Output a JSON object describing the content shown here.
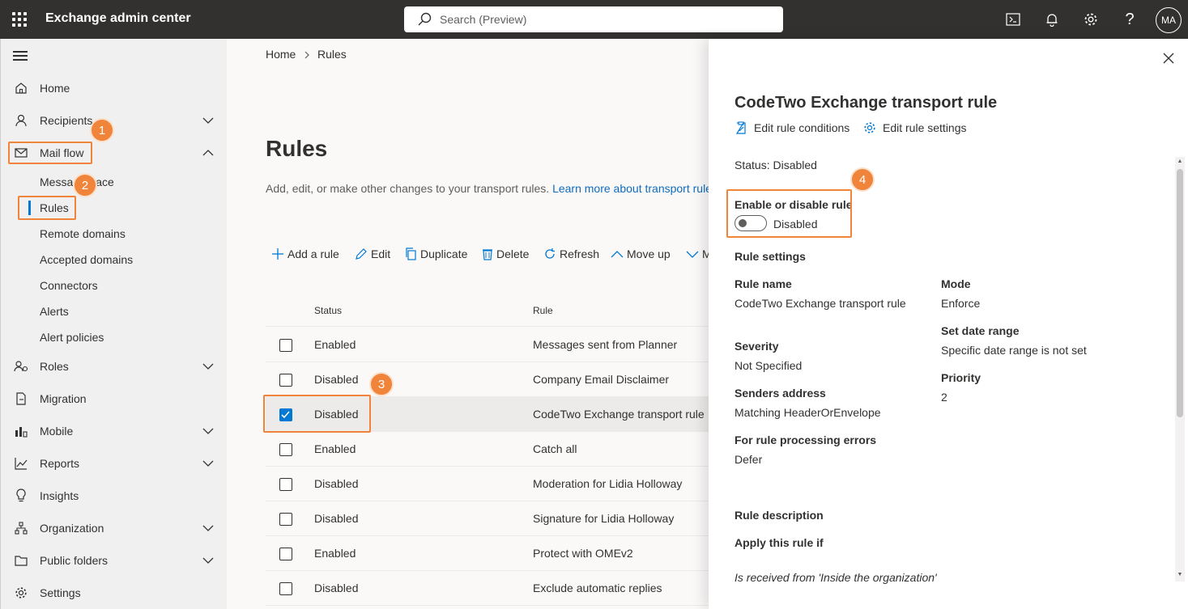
{
  "app": {
    "title": "Exchange admin center"
  },
  "search": {
    "placeholder": "Search (Preview)"
  },
  "header_icons": [
    "terminal-icon",
    "bell-icon",
    "gear-icon",
    "help-icon"
  ],
  "user": {
    "initials": "MA"
  },
  "sidebar": {
    "items": [
      {
        "label": "Home",
        "icon": "home-icon"
      },
      {
        "label": "Recipients",
        "icon": "person-icon",
        "expandable": true
      },
      {
        "label": "Mail flow",
        "icon": "mail-icon",
        "expanded": true
      },
      {
        "label": "Roles",
        "icon": "roles-icon",
        "expandable": true
      },
      {
        "label": "Migration",
        "icon": "migration-icon"
      },
      {
        "label": "Mobile",
        "icon": "mobile-icon",
        "expandable": true
      },
      {
        "label": "Reports",
        "icon": "reports-icon",
        "expandable": true
      },
      {
        "label": "Insights",
        "icon": "lightbulb-icon"
      },
      {
        "label": "Organization",
        "icon": "organization-icon",
        "expandable": true
      },
      {
        "label": "Public folders",
        "icon": "folder-icon",
        "expandable": true
      },
      {
        "label": "Settings",
        "icon": "gear-icon"
      }
    ],
    "mail_flow_sub": [
      "Message trace",
      "Rules",
      "Remote domains",
      "Accepted domains",
      "Connectors",
      "Alerts",
      "Alert policies"
    ]
  },
  "breadcrumb": {
    "home": "Home",
    "current": "Rules"
  },
  "page": {
    "title": "Rules",
    "description": "Add, edit, or make other changes to your transport rules.",
    "learn_more": "Learn more about transport rule"
  },
  "commands": [
    "Add a rule",
    "Edit",
    "Duplicate",
    "Delete",
    "Refresh",
    "Move up",
    "M"
  ],
  "table": {
    "columns": [
      "Status",
      "Rule"
    ],
    "rows": [
      {
        "status": "Enabled",
        "rule": "Messages sent from Planner",
        "checked": false
      },
      {
        "status": "Disabled",
        "rule": "Company Email Disclaimer",
        "checked": false
      },
      {
        "status": "Disabled",
        "rule": "CodeTwo Exchange transport rule",
        "checked": true
      },
      {
        "status": "Enabled",
        "rule": "Catch all",
        "checked": false
      },
      {
        "status": "Disabled",
        "rule": "Moderation for Lidia Holloway",
        "checked": false
      },
      {
        "status": "Disabled",
        "rule": "Signature for Lidia Holloway",
        "checked": false
      },
      {
        "status": "Enabled",
        "rule": "Protect with OMEv2",
        "checked": false
      },
      {
        "status": "Disabled",
        "rule": "Exclude automatic replies",
        "checked": false
      }
    ]
  },
  "panel": {
    "title": "CodeTwo Exchange transport rule",
    "edit_conditions": "Edit rule conditions",
    "edit_settings": "Edit rule settings",
    "status": "Status: Disabled",
    "enable_label": "Enable or disable rule",
    "toggle_state": "Disabled",
    "toggle_on": false,
    "settings_heading": "Rule settings",
    "rule_name_label": "Rule name",
    "rule_name": "CodeTwo Exchange transport rule",
    "mode_label": "Mode",
    "mode": "Enforce",
    "date_range_label": "Set date range",
    "date_range": "Specific date range is not set",
    "severity_label": "Severity",
    "severity": "Not Specified",
    "priority_label": "Priority",
    "priority": "2",
    "senders_label": "Senders address",
    "senders": "Matching HeaderOrEnvelope",
    "errors_label": "For rule processing errors",
    "errors": "Defer",
    "description_heading": "Rule description",
    "apply_if": "Apply this rule if",
    "condition": "Is received from 'Inside the organization'"
  },
  "steps": [
    "1",
    "2",
    "3",
    "4"
  ],
  "colors": {
    "accent": "#0078d4",
    "highlight": "#f0843a",
    "topbar": "#323130"
  }
}
